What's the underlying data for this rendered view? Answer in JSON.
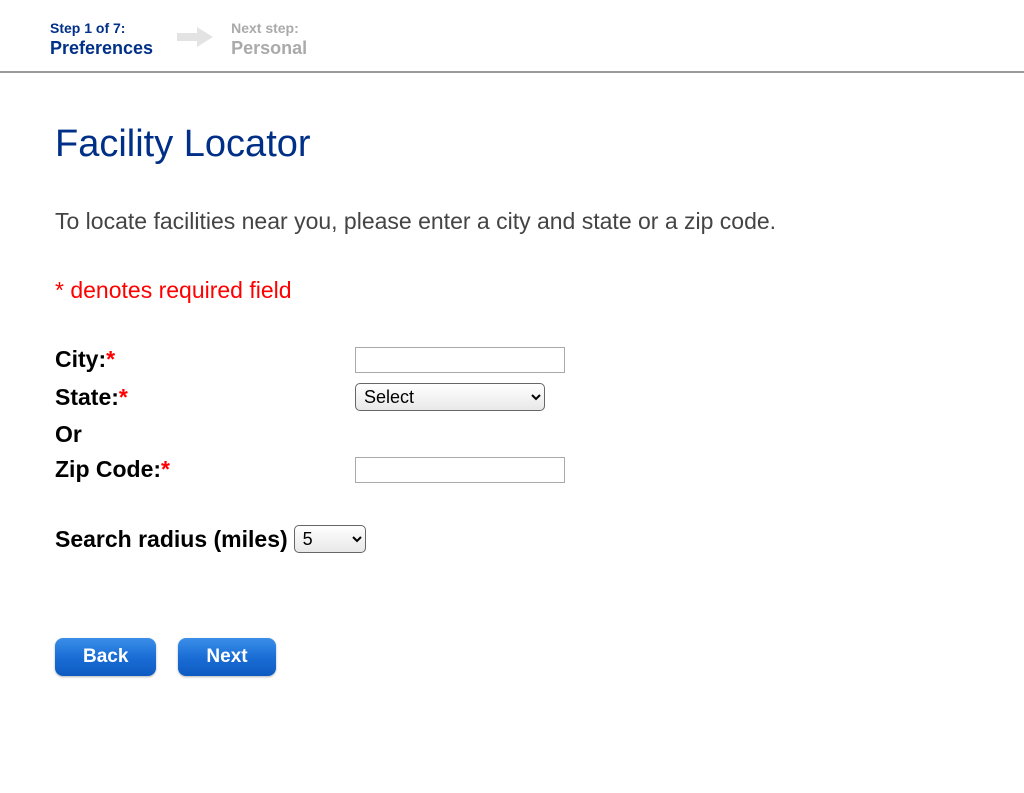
{
  "stepper": {
    "current_label": "Step 1 of 7:",
    "current_name": "Preferences",
    "next_label": "Next step:",
    "next_name": "Personal"
  },
  "page": {
    "title": "Facility Locator",
    "instructions": "To locate facilities near you, please enter a city and state or a zip code.",
    "required_note": "* denotes required field"
  },
  "form": {
    "city_label": "City:",
    "city_value": "",
    "state_label": "State:",
    "state_selected": "Select",
    "or_label": "Or",
    "zip_label": "Zip Code:",
    "zip_value": "",
    "radius_label": "Search radius (miles)",
    "radius_selected": "5",
    "asterisk": "*"
  },
  "buttons": {
    "back": "Back",
    "next": "Next"
  }
}
